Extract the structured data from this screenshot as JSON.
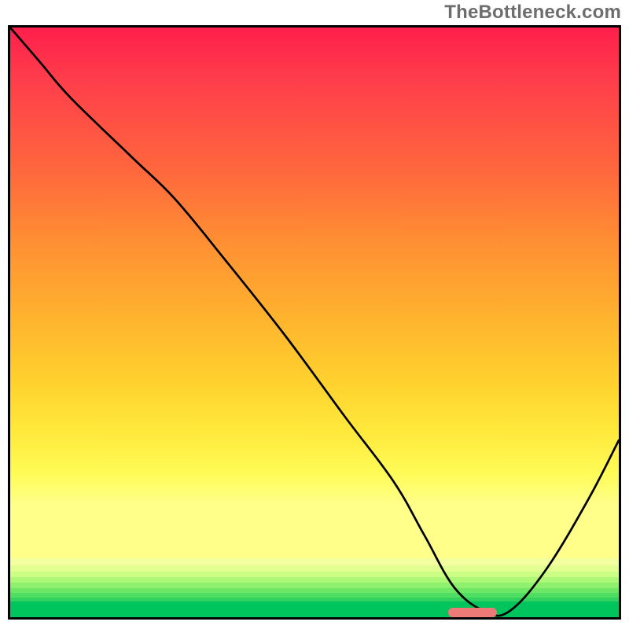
{
  "watermark": "TheBottleneck.com",
  "chart_data": {
    "type": "line",
    "title": "",
    "xlabel": "",
    "ylabel": "",
    "xlim": [
      0,
      100
    ],
    "ylim": [
      0,
      100
    ],
    "grid": false,
    "x": [
      0,
      5,
      10,
      20,
      27,
      35,
      45,
      55,
      63,
      68,
      73,
      78,
      82,
      88,
      95,
      100
    ],
    "values": [
      100,
      94,
      88,
      78,
      71,
      61,
      48,
      34,
      23,
      14,
      5,
      1,
      1,
      8,
      20,
      30
    ],
    "marker": {
      "x_start": 72,
      "x_end": 80,
      "y": 0.5
    },
    "gradient_stops": [
      {
        "pos": 0,
        "color": "#ff1f4b"
      },
      {
        "pos": 10,
        "color": "#ff3e4b"
      },
      {
        "pos": 28,
        "color": "#ff6a3c"
      },
      {
        "pos": 40,
        "color": "#ff8e33"
      },
      {
        "pos": 55,
        "color": "#ffb42e"
      },
      {
        "pos": 67,
        "color": "#ffd22e"
      },
      {
        "pos": 76,
        "color": "#ffe93b"
      },
      {
        "pos": 84,
        "color": "#fffb57"
      },
      {
        "pos": 90,
        "color": "#ffff8a"
      }
    ],
    "bottom_bands": [
      {
        "top": 90.0,
        "height": 1.2,
        "color": "#f4ff9f"
      },
      {
        "top": 91.2,
        "height": 1.0,
        "color": "#e2ff92"
      },
      {
        "top": 92.2,
        "height": 1.0,
        "color": "#caff84"
      },
      {
        "top": 93.2,
        "height": 0.9,
        "color": "#aef878"
      },
      {
        "top": 94.1,
        "height": 0.9,
        "color": "#8ff06e"
      },
      {
        "top": 95.0,
        "height": 0.8,
        "color": "#6ee766"
      },
      {
        "top": 95.8,
        "height": 0.8,
        "color": "#4fdd62"
      },
      {
        "top": 96.6,
        "height": 0.7,
        "color": "#32d160"
      },
      {
        "top": 97.3,
        "height": 2.7,
        "color": "#00c55c"
      }
    ]
  }
}
